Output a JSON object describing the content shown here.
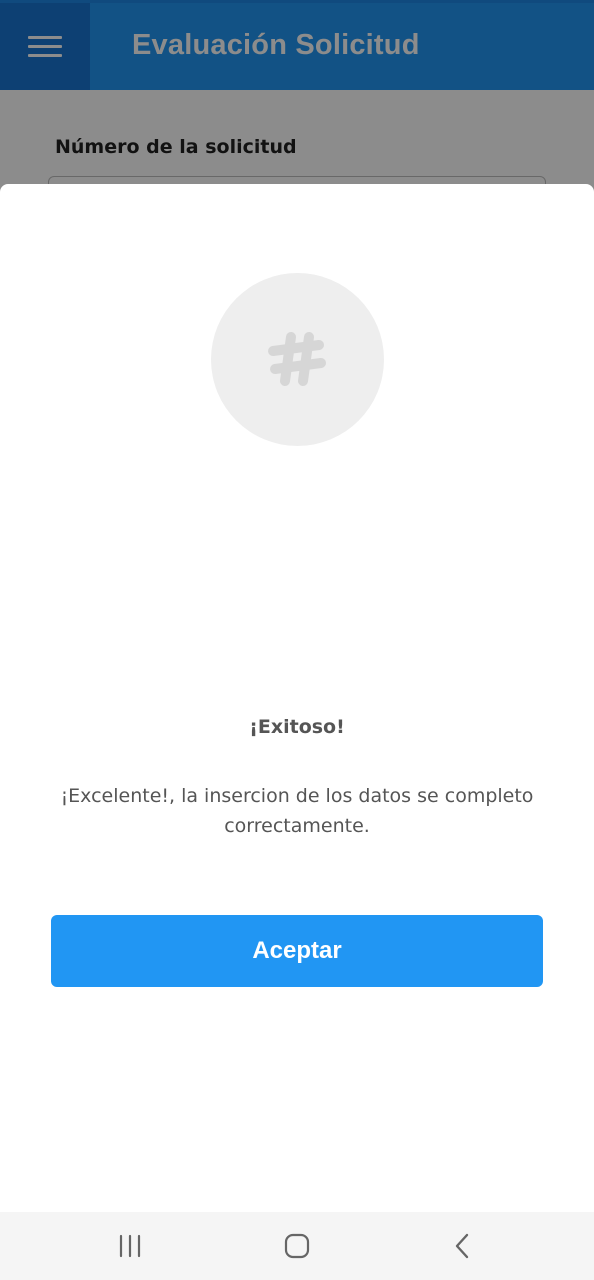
{
  "app_bar": {
    "title": "Evaluación Solicitud",
    "menu_icon": "hamburger-menu-icon"
  },
  "form": {
    "request_number_label": "Número de la solicitud",
    "request_number_value": ""
  },
  "dialog": {
    "icon": "hashtag-icon",
    "title": "¡Exitoso!",
    "message": "¡Excelente!, la insercion de los datos se completo correctamente.",
    "accept_label": "Aceptar"
  },
  "system_nav": {
    "recents_icon": "recent-apps-icon",
    "home_icon": "home-icon",
    "back_icon": "back-icon"
  },
  "colors": {
    "primary": "#2196F3",
    "primary_dark": "#1976D2",
    "text_gray": "#555555",
    "icon_circle": "#eeeeee",
    "icon_glyph": "#d6d6d6"
  }
}
